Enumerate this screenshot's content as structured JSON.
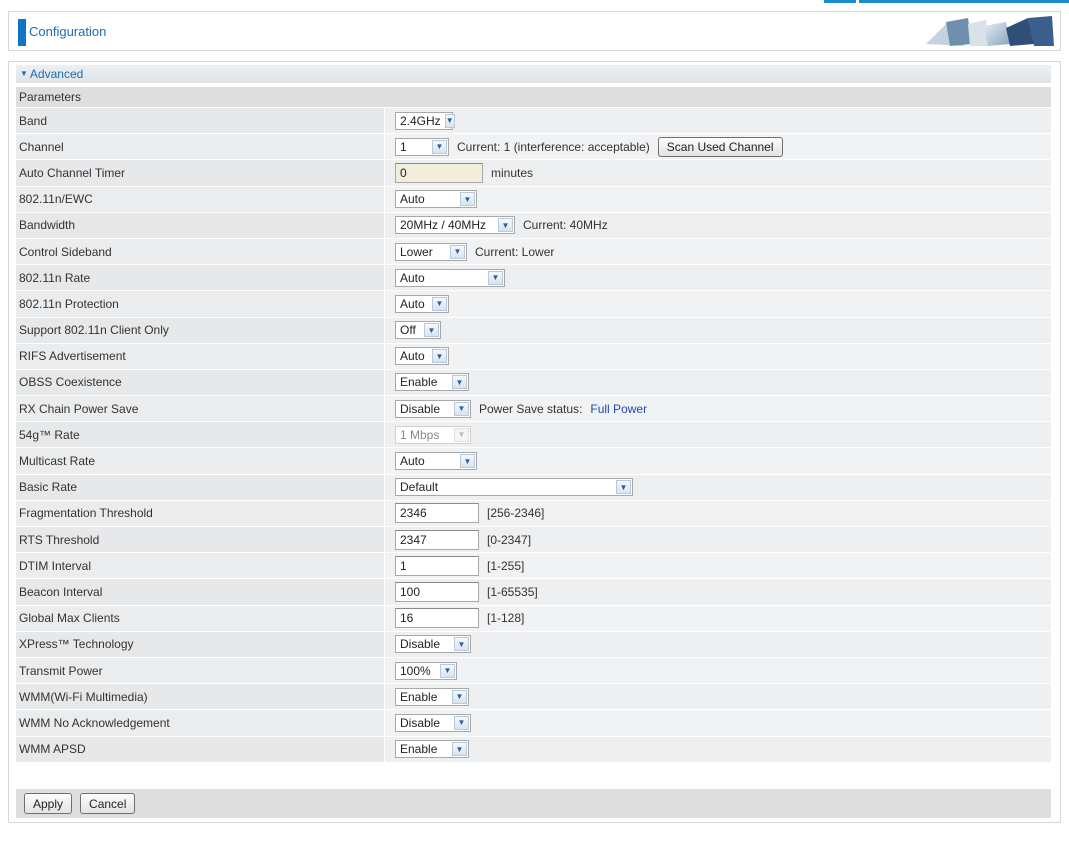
{
  "header": {
    "title": "Configuration"
  },
  "section": {
    "title": "Advanced",
    "subheader": "Parameters"
  },
  "rows": {
    "band": {
      "label": "Band",
      "value": "2.4GHz"
    },
    "channel": {
      "label": "Channel",
      "value": "1",
      "current": "Current: 1 (interference: acceptable)",
      "scan_button": "Scan Used Channel"
    },
    "auto_channel_timer": {
      "label": "Auto Channel Timer",
      "value": "0",
      "unit": "minutes"
    },
    "n_ewc": {
      "label": "802.11n/EWC",
      "value": "Auto"
    },
    "bandwidth": {
      "label": "Bandwidth",
      "value": "20MHz / 40MHz",
      "current": "Current: 40MHz"
    },
    "control_sideband": {
      "label": "Control Sideband",
      "value": "Lower",
      "current": "Current: Lower"
    },
    "n_rate": {
      "label": "802.11n Rate",
      "value": "Auto"
    },
    "n_protection": {
      "label": "802.11n Protection",
      "value": "Auto"
    },
    "support_n_only": {
      "label": "Support 802.11n Client Only",
      "value": "Off"
    },
    "rifs": {
      "label": "RIFS Advertisement",
      "value": "Auto"
    },
    "obss": {
      "label": "OBSS Coexistence",
      "value": "Enable"
    },
    "rx_chain": {
      "label": "RX Chain Power Save",
      "value": "Disable",
      "status_label": "Power Save status:",
      "status_value": "Full Power"
    },
    "g_rate": {
      "label": "54g™ Rate",
      "value": "1 Mbps"
    },
    "multicast_rate": {
      "label": "Multicast Rate",
      "value": "Auto"
    },
    "basic_rate": {
      "label": "Basic Rate",
      "value": "Default"
    },
    "frag_threshold": {
      "label": "Fragmentation Threshold",
      "value": "2346",
      "range": "[256-2346]"
    },
    "rts_threshold": {
      "label": "RTS Threshold",
      "value": "2347",
      "range": "[0-2347]"
    },
    "dtim": {
      "label": "DTIM Interval",
      "value": "1",
      "range": "[1-255]"
    },
    "beacon": {
      "label": "Beacon Interval",
      "value": "100",
      "range": "[1-65535]"
    },
    "max_clients": {
      "label": "Global Max Clients",
      "value": "16",
      "range": "[1-128]"
    },
    "xpress": {
      "label": "XPress™ Technology",
      "value": "Disable"
    },
    "tx_power": {
      "label": "Transmit Power",
      "value": "100%"
    },
    "wmm": {
      "label": "WMM(Wi-Fi Multimedia)",
      "value": "Enable"
    },
    "wmm_noack": {
      "label": "WMM No Acknowledgement",
      "value": "Disable"
    },
    "wmm_apsd": {
      "label": "WMM APSD",
      "value": "Enable"
    }
  },
  "buttons": {
    "apply": "Apply",
    "cancel": "Cancel"
  },
  "icons": {
    "dropdown": "chevron-down-icon",
    "collapse": "triangle-down-icon"
  },
  "colors": {
    "accent": "#1175c7",
    "link": "#2046b8",
    "input_tan": "#f3eddc"
  }
}
